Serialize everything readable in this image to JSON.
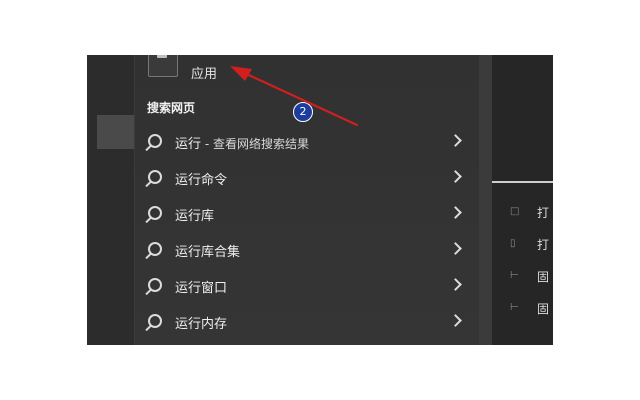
{
  "best_match": {
    "label": "应用"
  },
  "search_web": {
    "title": "搜索网页",
    "step_badge": "2"
  },
  "results": [
    {
      "label": "运行",
      "suffix": " - 查看网络搜索结果"
    },
    {
      "label": "运行命令",
      "suffix": ""
    },
    {
      "label": "运行库",
      "suffix": ""
    },
    {
      "label": "运行库合集",
      "suffix": ""
    },
    {
      "label": "运行窗口",
      "suffix": ""
    },
    {
      "label": "运行内存",
      "suffix": ""
    }
  ],
  "right_pane": {
    "items": [
      {
        "icon": "open-location-icon",
        "label": "打"
      },
      {
        "icon": "open-file-icon",
        "label": "打"
      },
      {
        "icon": "pin-icon",
        "label": "固"
      },
      {
        "icon": "pin-icon",
        "label": "固"
      }
    ]
  },
  "colors": {
    "annotation_arrow": "#d11f1f",
    "badge": "#1d3d9e",
    "panel": "#333333"
  }
}
